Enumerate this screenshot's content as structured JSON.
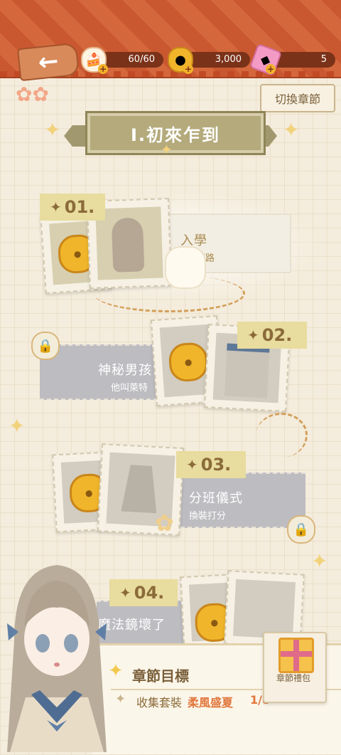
{
  "header": {
    "back_icon": "arrow-left-icon",
    "resources": [
      {
        "name": "stamina",
        "icon": "cake-icon",
        "value": "60/60"
      },
      {
        "name": "coins",
        "icon": "coin-icon",
        "value": "3,000"
      },
      {
        "name": "gems",
        "icon": "gem-icon",
        "value": "5"
      }
    ]
  },
  "switch_chapter_label": "切換章節",
  "chapter_title": "I.初來乍到",
  "stages": [
    {
      "number": "01.",
      "title": "入學",
      "subtitle": "開學迷路",
      "status": "active"
    },
    {
      "number": "02.",
      "title": "神秘男孩",
      "subtitle": "他叫萊特",
      "status": "locked"
    },
    {
      "number": "03.",
      "title": "分班儀式",
      "subtitle": "換裝打分",
      "status": "locked"
    },
    {
      "number": "04.",
      "title": "魔法鏡壞了",
      "subtitle": "",
      "status": "locked"
    }
  ],
  "goal": {
    "heading": "章節目標",
    "prefix": "收集套裝",
    "set_name": "柔風盛夏",
    "progress": "1/8"
  },
  "gift": {
    "label": "章節禮包"
  },
  "colors": {
    "topbar": "#c9572f",
    "accent": "#e1773d",
    "gold": "#f0b52a",
    "locked": "#bdbcc0"
  }
}
